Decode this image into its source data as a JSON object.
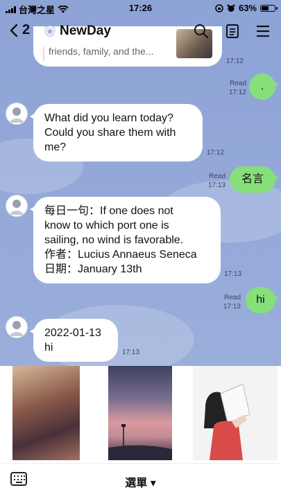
{
  "status_bar": {
    "carrier": "台灣之星",
    "time": "17:26",
    "battery": "63%",
    "battery_level": 0.63
  },
  "header": {
    "back_count": "2",
    "title": "NewDay"
  },
  "top_card": {
    "preview": "friends, family, and the...",
    "time": "17:12"
  },
  "messages": [
    {
      "from": "me",
      "text": ".",
      "read": "Read",
      "time": "17:12"
    },
    {
      "from": "them",
      "lines": [
        "What did you learn today?",
        "Could you share them with",
        "me?"
      ],
      "time": "17:12"
    },
    {
      "from": "me",
      "text": "名言",
      "read": "Read",
      "time": "17:13"
    },
    {
      "from": "them",
      "lines": [
        "每日一句：If one does not",
        "know to which port one is",
        "sailing, no wind is favorable.",
        "作者：Lucius Annaeus Seneca",
        "日期：January 13th"
      ],
      "time": "17:13"
    },
    {
      "from": "me",
      "text": "hi",
      "read": "Read",
      "time": "17:13"
    },
    {
      "from": "them",
      "lines": [
        "2022-01-13",
        "hi"
      ],
      "time": "17:13"
    }
  ],
  "bottom": {
    "menu_label": "選單 ▾"
  },
  "colors": {
    "chat_bg": "#8ea3d3",
    "my_bubble": "#86e07a",
    "their_bubble": "#ffffff"
  }
}
